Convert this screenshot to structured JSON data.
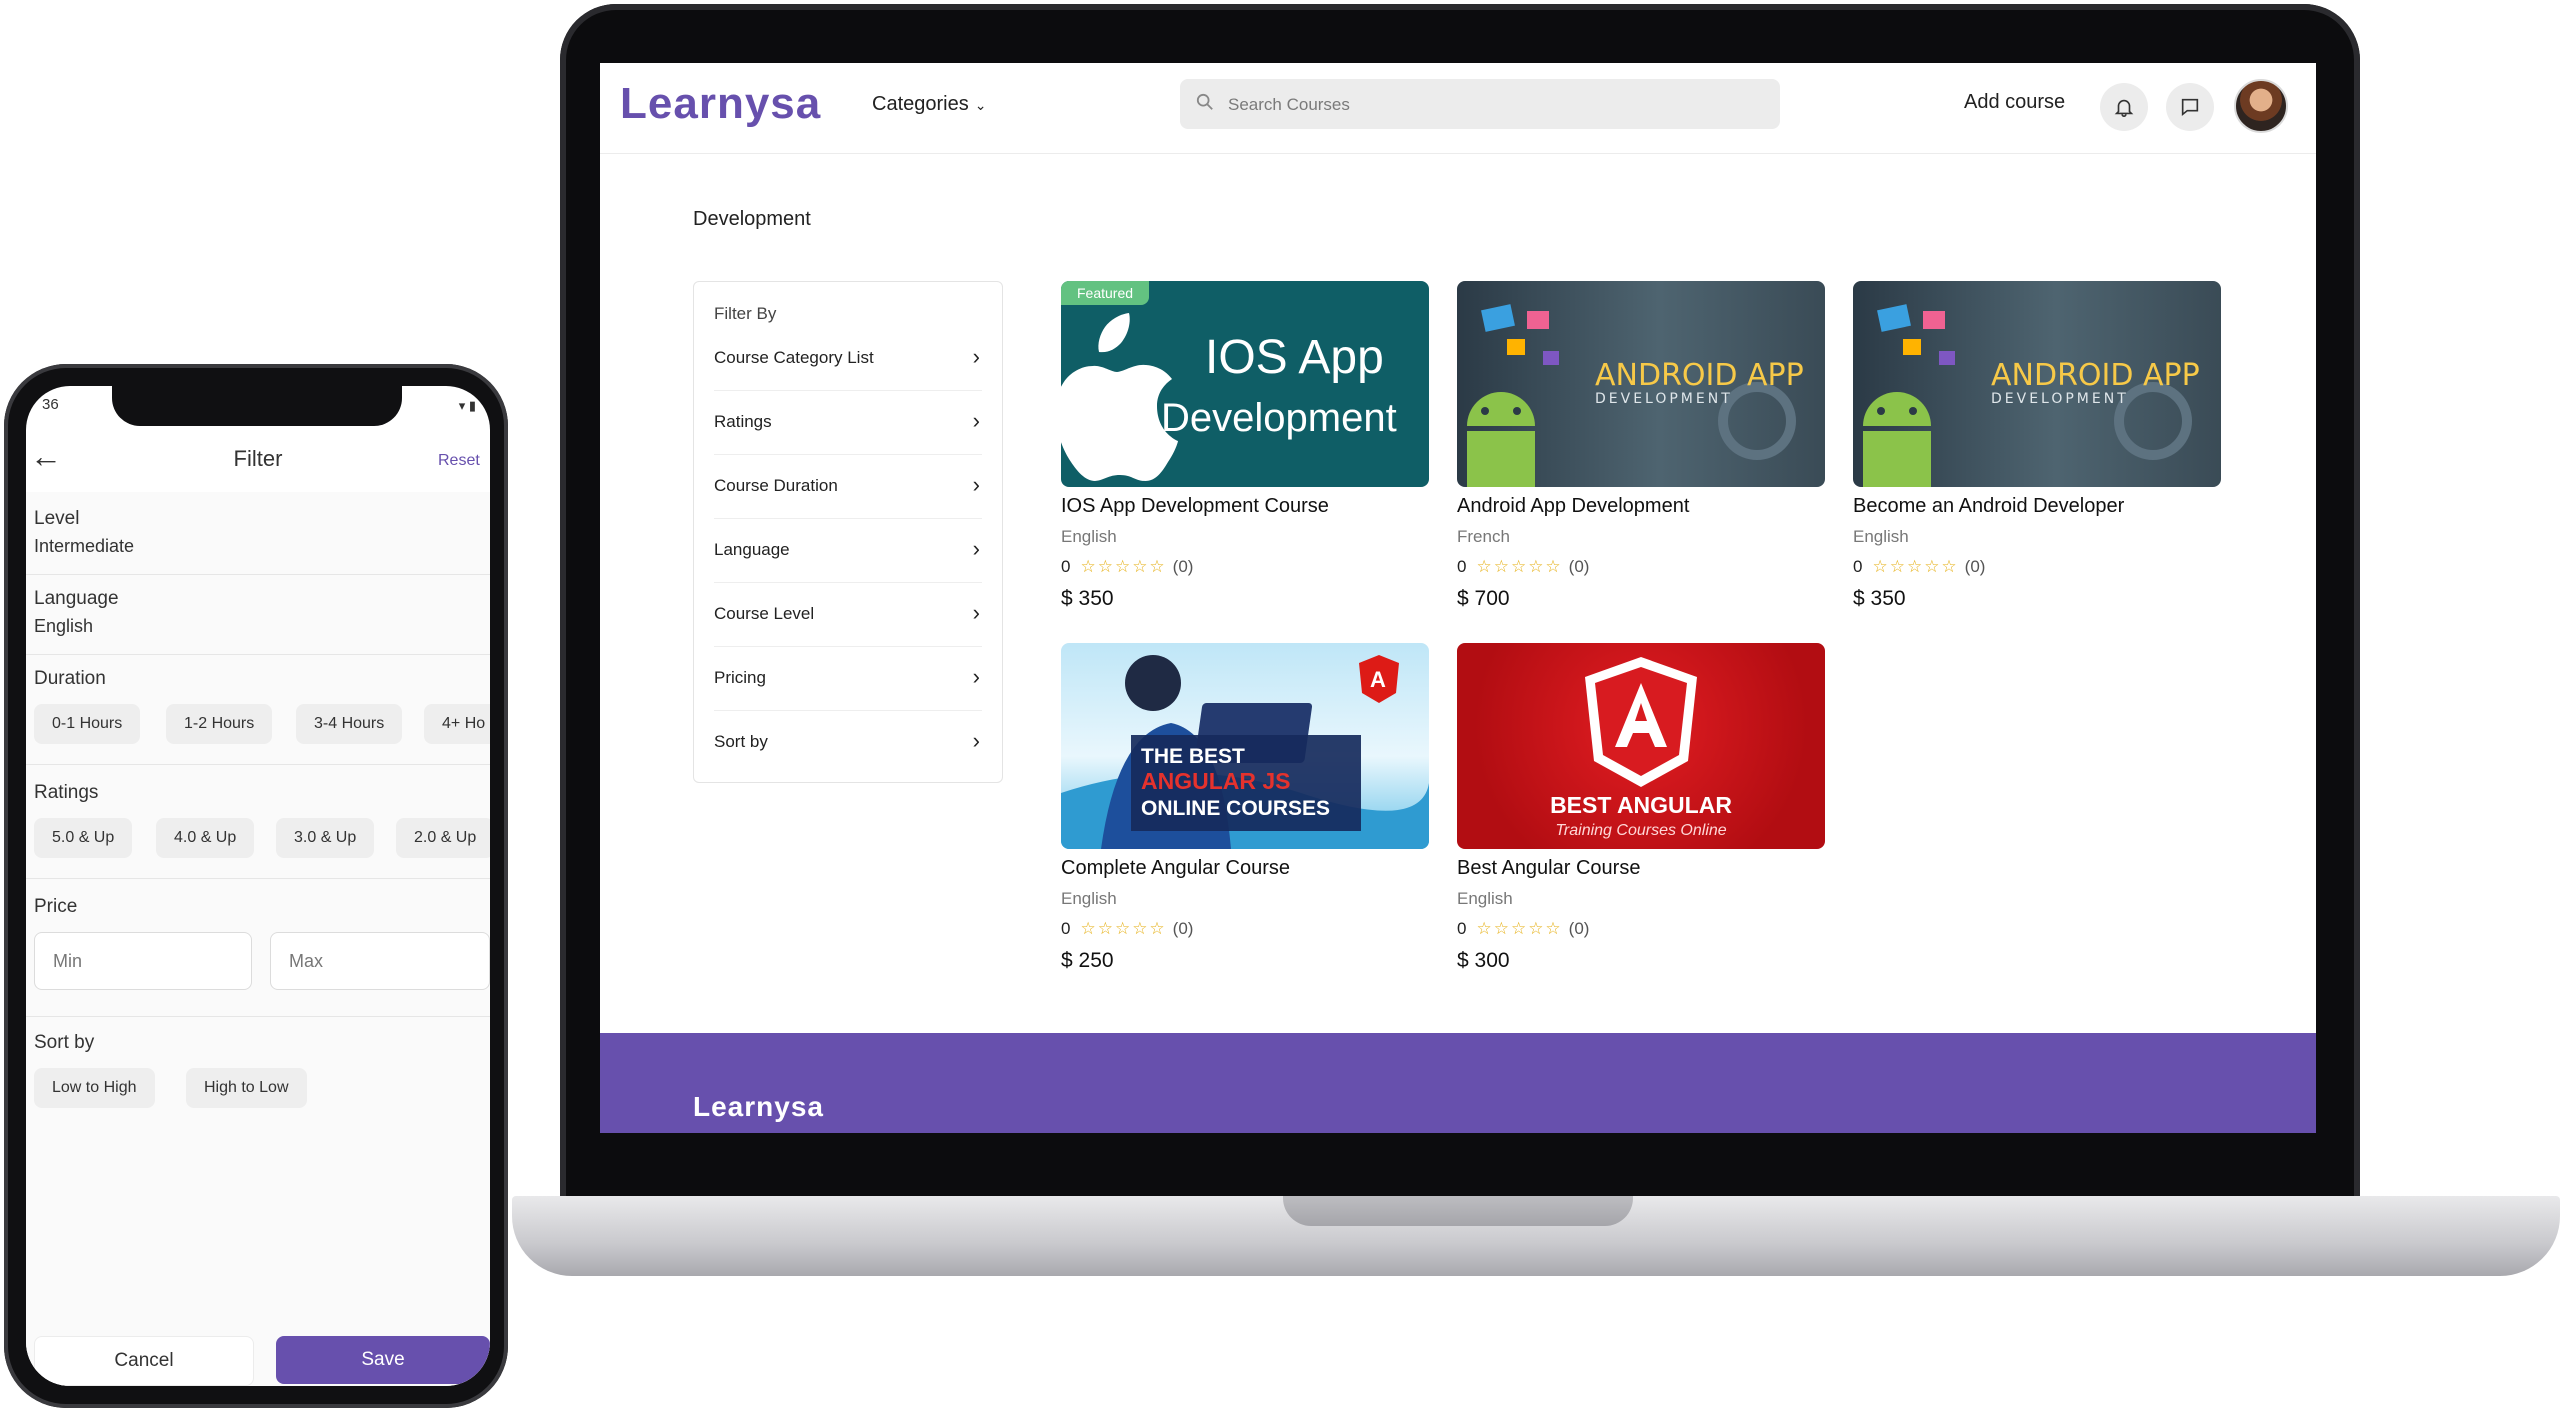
{
  "laptop": {
    "header": {
      "logo": "Learnysa",
      "categories_label": "Categories",
      "search_placeholder": "Search Courses",
      "add_course_label": "Add course"
    },
    "section_title": "Development",
    "filter": {
      "title": "Filter By",
      "items": [
        {
          "label": "Course Category List"
        },
        {
          "label": "Ratings"
        },
        {
          "label": "Course Duration"
        },
        {
          "label": "Language"
        },
        {
          "label": "Course Level"
        },
        {
          "label": "Pricing"
        },
        {
          "label": "Sort by"
        }
      ]
    },
    "courses": [
      {
        "title": "IOS App Development Course",
        "language": "English",
        "rating": "0",
        "stars": "☆☆☆☆☆",
        "count": "(0)",
        "price": "$ 350",
        "badge": "Featured",
        "thumb_text": [
          "IOS App",
          "Development"
        ]
      },
      {
        "title": "Android App Development",
        "language": "French",
        "rating": "0",
        "stars": "☆☆☆☆☆",
        "count": "(0)",
        "price": "$ 700",
        "thumb_text": [
          "ANDROID APP",
          "DEVELOPMENT"
        ]
      },
      {
        "title": "Become an Android Developer",
        "language": "English",
        "rating": "0",
        "stars": "☆☆☆☆☆",
        "count": "(0)",
        "price": "$ 350",
        "thumb_text": [
          "ANDROID APP",
          "DEVELOPMENT"
        ]
      },
      {
        "title": "Complete Angular Course",
        "language": "English",
        "rating": "0",
        "stars": "☆☆☆☆☆",
        "count": "(0)",
        "price": "$ 250",
        "thumb_text": [
          "THE BEST",
          "ANGULAR JS",
          "ONLINE COURSES"
        ]
      },
      {
        "title": "Best Angular Course",
        "language": "English",
        "rating": "0",
        "stars": "☆☆☆☆☆",
        "count": "(0)",
        "price": "$ 300",
        "thumb_text": [
          "BEST ANGULAR",
          "Training Courses Online"
        ]
      }
    ],
    "footer_logo": "Learnysa"
  },
  "phone": {
    "time": "36",
    "title": "Filter",
    "reset_label": "Reset",
    "level": {
      "title": "Level",
      "value": "Intermediate"
    },
    "language": {
      "title": "Language",
      "value": "English"
    },
    "duration": {
      "title": "Duration",
      "options": [
        "0-1 Hours",
        "1-2 Hours",
        "3-4 Hours",
        "4+ Ho"
      ]
    },
    "ratings": {
      "title": "Ratings",
      "options": [
        "5.0 & Up",
        "4.0 & Up",
        "3.0 & Up",
        "2.0 & Up"
      ]
    },
    "price": {
      "title": "Price",
      "min_placeholder": "Min",
      "max_placeholder": "Max"
    },
    "sort": {
      "title": "Sort by",
      "options": [
        "Low to High",
        "High to Low"
      ]
    },
    "cancel_label": "Cancel",
    "save_label": "Save"
  },
  "colors": {
    "brand": "#6750ad",
    "featured": "#63c281",
    "star": "#e7b21a"
  }
}
